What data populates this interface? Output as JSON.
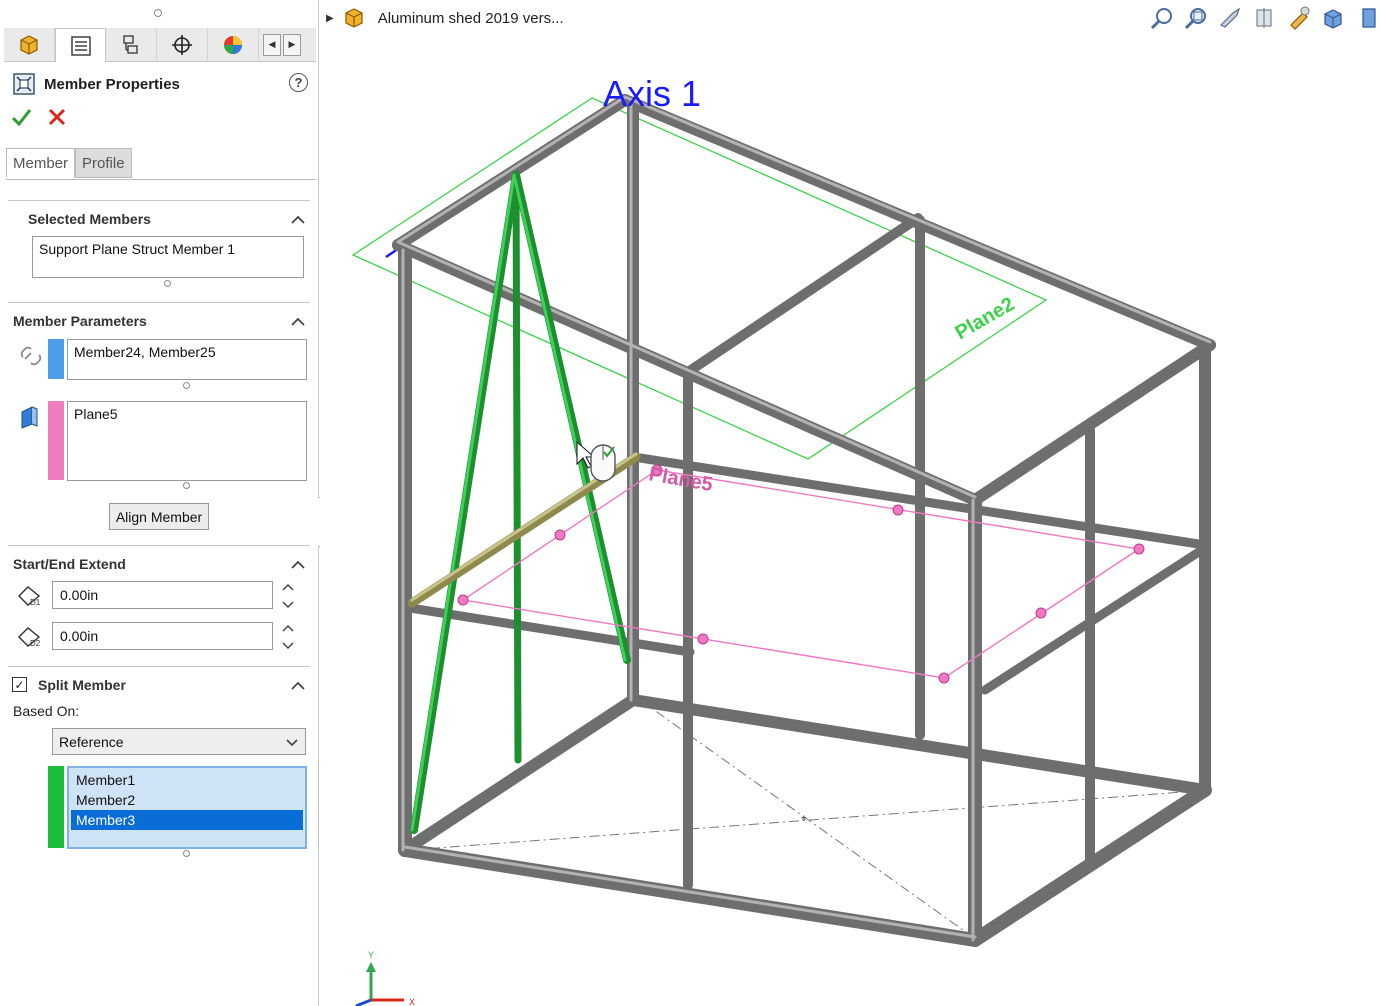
{
  "panel": {
    "title": "Member Properties",
    "help_label": "?",
    "tabs": [
      {
        "icon": "feature-manager-icon"
      },
      {
        "icon": "property-manager-icon"
      },
      {
        "icon": "configuration-manager-icon"
      },
      {
        "icon": "dimxpert-icon"
      },
      {
        "icon": "display-manager-icon"
      }
    ],
    "sub_tabs": {
      "member": "Member",
      "profile": "Profile"
    },
    "selected_members": {
      "title": "Selected Members",
      "value": "Support Plane Struct Member 1"
    },
    "member_parameters": {
      "title": "Member Parameters",
      "members_value": "Member24, Member25",
      "plane_value": "Plane5",
      "align_button": "Align Member",
      "members_color": "#4a9fe8",
      "plane_color": "#f07cc0"
    },
    "start_end_extend": {
      "title": "Start/End Extend",
      "d1_value": "0.00in",
      "d2_value": "0.00in"
    },
    "split_member": {
      "title": "Split Member",
      "checked": true,
      "based_on_label": "Based On:",
      "based_on_value": "Reference",
      "reference_color": "#1ebd3a",
      "references": [
        "Member1",
        "Member2",
        "Member3"
      ],
      "selected_reference": "Member3"
    }
  },
  "viewport": {
    "tree_title": "Aluminum shed 2019 vers...",
    "labels": {
      "axis": "Axis 1",
      "plane_top": "Plane2",
      "plane_mid": "Plane5"
    },
    "triad": {
      "y": "Y",
      "x": "X"
    },
    "toolbar_icons": [
      "zoom-to-fit-icon",
      "zoom-to-area-icon",
      "previous-view-icon",
      "section-view-icon",
      "view-selector-icon",
      "view-orientation-icon",
      "display-style-icon"
    ]
  }
}
